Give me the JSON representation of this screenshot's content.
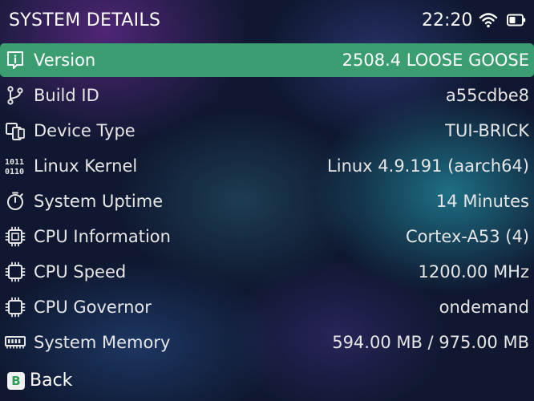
{
  "header": {
    "title": "SYSTEM DETAILS",
    "clock": "22:20",
    "wifi_icon": "wifi-icon",
    "battery_icon": "battery-icon"
  },
  "rows": [
    {
      "icon": "info-icon",
      "label": "Version",
      "value": "2508.4 LOOSE GOOSE",
      "selected": true
    },
    {
      "icon": "git-branch-icon",
      "label": "Build ID",
      "value": "a55cdbe8",
      "selected": false
    },
    {
      "icon": "devices-icon",
      "label": "Device Type",
      "value": "TUI-BRICK",
      "selected": false
    },
    {
      "icon": "binary-icon",
      "label": "Linux Kernel",
      "value": "Linux 4.9.191 (aarch64)",
      "selected": false
    },
    {
      "icon": "stopwatch-icon",
      "label": "System Uptime",
      "value": "14 Minutes",
      "selected": false
    },
    {
      "icon": "cpu-icon",
      "label": "CPU Information",
      "value": "Cortex-A53 (4)",
      "selected": false
    },
    {
      "icon": "cpu-icon",
      "label": "CPU Speed",
      "value": "1200.00 MHz",
      "selected": false
    },
    {
      "icon": "cpu-icon",
      "label": "CPU Governor",
      "value": "ondemand",
      "selected": false
    },
    {
      "icon": "memory-icon",
      "label": "System Memory",
      "value": "594.00 MB / 975.00 MB",
      "selected": false
    }
  ],
  "footer": {
    "button_glyph": "B",
    "back_label": "Back"
  },
  "colors": {
    "selected_row": "#3a9e70",
    "b_badge_text": "#2e9e5a",
    "text": "#e6e6e6"
  }
}
